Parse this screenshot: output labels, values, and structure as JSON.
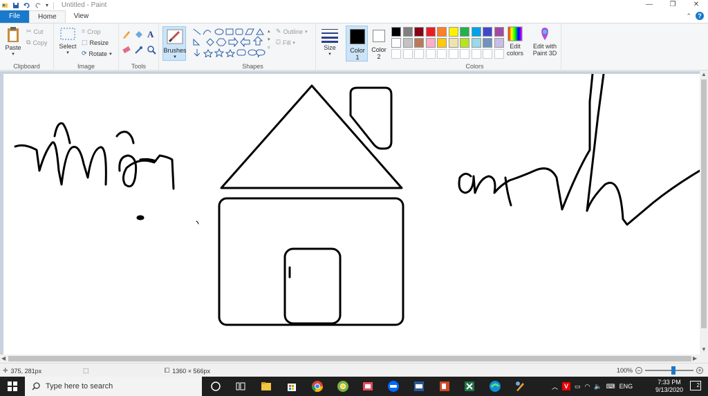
{
  "window": {
    "title": "Untitled - Paint",
    "minimize_glyph": "—",
    "maximize_glyph": "❐",
    "close_glyph": "✕"
  },
  "tabs": [
    {
      "label": "File"
    },
    {
      "label": "Home"
    },
    {
      "label": "View"
    }
  ],
  "help_glyph": "?",
  "ribbon": {
    "clipboard": {
      "label": "Clipboard",
      "paste": "Paste",
      "cut": "Cut",
      "copy": "Copy"
    },
    "image": {
      "label": "Image",
      "select": "Select",
      "crop": "Crop",
      "resize": "Resize",
      "rotate": "Rotate"
    },
    "tools": {
      "label": "Tools",
      "text_tool_glyph": "A"
    },
    "brushes": {
      "label": "Brushes"
    },
    "shapes": {
      "label": "Shapes",
      "outline": "Outline",
      "fill": "Fill"
    },
    "size": {
      "label": "Size"
    },
    "color1": {
      "label": "Color",
      "number": "1",
      "color": "#000000"
    },
    "color2": {
      "label": "Color",
      "number": "2",
      "color": "#ffffff"
    },
    "colors": {
      "label": "Colors",
      "edit_colors": "Edit colors",
      "row1": [
        "#000000",
        "#7f7f7f",
        "#880015",
        "#ed1c24",
        "#ff7f27",
        "#fff200",
        "#22b14c",
        "#00a2e8",
        "#3f48cc",
        "#a349a4"
      ],
      "row2": [
        "#ffffff",
        "#c3c3c3",
        "#b97a57",
        "#ffaec9",
        "#ffc90e",
        "#efe4b0",
        "#b5e61d",
        "#99d9ea",
        "#7092be",
        "#c8bfe7"
      ]
    },
    "paint3d": {
      "label": "Edit with Paint 3D"
    }
  },
  "status": {
    "cursor_pos": "375, 281px",
    "canvas_size": "1360 × 566px",
    "zoom": "100%",
    "zoom_fraction": 0.6
  },
  "taskbar": {
    "search_placeholder": "Type here to search",
    "lang": "ENG",
    "time": "7:33 PM",
    "date": "9/13/2020",
    "notif_count": "2"
  }
}
